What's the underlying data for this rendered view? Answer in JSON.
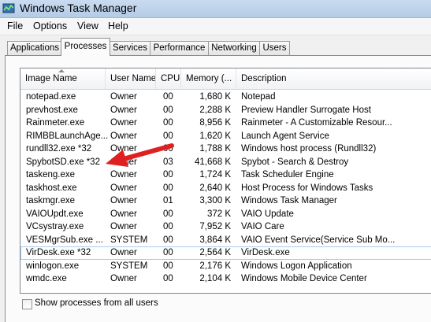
{
  "window": {
    "title": "Windows Task Manager"
  },
  "menu": [
    "File",
    "Options",
    "View",
    "Help"
  ],
  "tabs": [
    {
      "label": "Applications"
    },
    {
      "label": "Processes"
    },
    {
      "label": "Services"
    },
    {
      "label": "Performance"
    },
    {
      "label": "Networking"
    },
    {
      "label": "Users"
    }
  ],
  "active_tab": "Processes",
  "columns": [
    "Image Name",
    "User Name",
    "CPU",
    "Memory (...",
    "Description"
  ],
  "processes": [
    {
      "name": "notepad.exe",
      "user": "Owner",
      "cpu": "00",
      "memory": "1,680 K",
      "description": "Notepad"
    },
    {
      "name": "prevhost.exe",
      "user": "Owner",
      "cpu": "00",
      "memory": "2,288 K",
      "description": "Preview Handler Surrogate Host"
    },
    {
      "name": "Rainmeter.exe",
      "user": "Owner",
      "cpu": "00",
      "memory": "8,956 K",
      "description": "Rainmeter - A Customizable Resour..."
    },
    {
      "name": "RIMBBLaunchAge...",
      "user": "Owner",
      "cpu": "00",
      "memory": "1,620 K",
      "description": "Launch Agent Service"
    },
    {
      "name": "rundll32.exe *32",
      "user": "Owner",
      "cpu": "00",
      "memory": "1,788 K",
      "description": "Windows host process (Rundll32)"
    },
    {
      "name": "SpybotSD.exe *32",
      "user": "Owner",
      "cpu": "03",
      "memory": "41,668 K",
      "description": "Spybot - Search & Destroy"
    },
    {
      "name": "taskeng.exe",
      "user": "Owner",
      "cpu": "00",
      "memory": "1,724 K",
      "description": "Task Scheduler Engine"
    },
    {
      "name": "taskhost.exe",
      "user": "Owner",
      "cpu": "00",
      "memory": "2,640 K",
      "description": "Host Process for Windows Tasks"
    },
    {
      "name": "taskmgr.exe",
      "user": "Owner",
      "cpu": "01",
      "memory": "3,300 K",
      "description": "Windows Task Manager"
    },
    {
      "name": "VAIOUpdt.exe",
      "user": "Owner",
      "cpu": "00",
      "memory": "372 K",
      "description": "VAIO Update"
    },
    {
      "name": "VCsystray.exe",
      "user": "Owner",
      "cpu": "00",
      "memory": "7,952 K",
      "description": "VAIO Care"
    },
    {
      "name": "VESMgrSub.exe ...",
      "user": "SYSTEM",
      "cpu": "00",
      "memory": "3,864 K",
      "description": "VAIO Event Service(Service Sub Mo..."
    },
    {
      "name": "VirDesk.exe *32",
      "user": "Owner",
      "cpu": "00",
      "memory": "2,564 K",
      "description": "VirDesk.exe"
    },
    {
      "name": "winlogon.exe",
      "user": "SYSTEM",
      "cpu": "00",
      "memory": "2,176 K",
      "description": "Windows Logon Application"
    },
    {
      "name": "wmdc.exe",
      "user": "Owner",
      "cpu": "00",
      "memory": "2,104 K",
      "description": "Windows Mobile Device Center"
    }
  ],
  "selected_process": "VirDesk.exe *32",
  "show_all_checkbox": {
    "label": "Show processes from all users",
    "checked": false
  },
  "annotation": {
    "type": "red-arrow",
    "points_to": "SpybotSD.exe *32",
    "color": "#e02020"
  },
  "colors": {
    "titlebar": "#c9dbf0",
    "selection_border": "#a8cbee"
  }
}
